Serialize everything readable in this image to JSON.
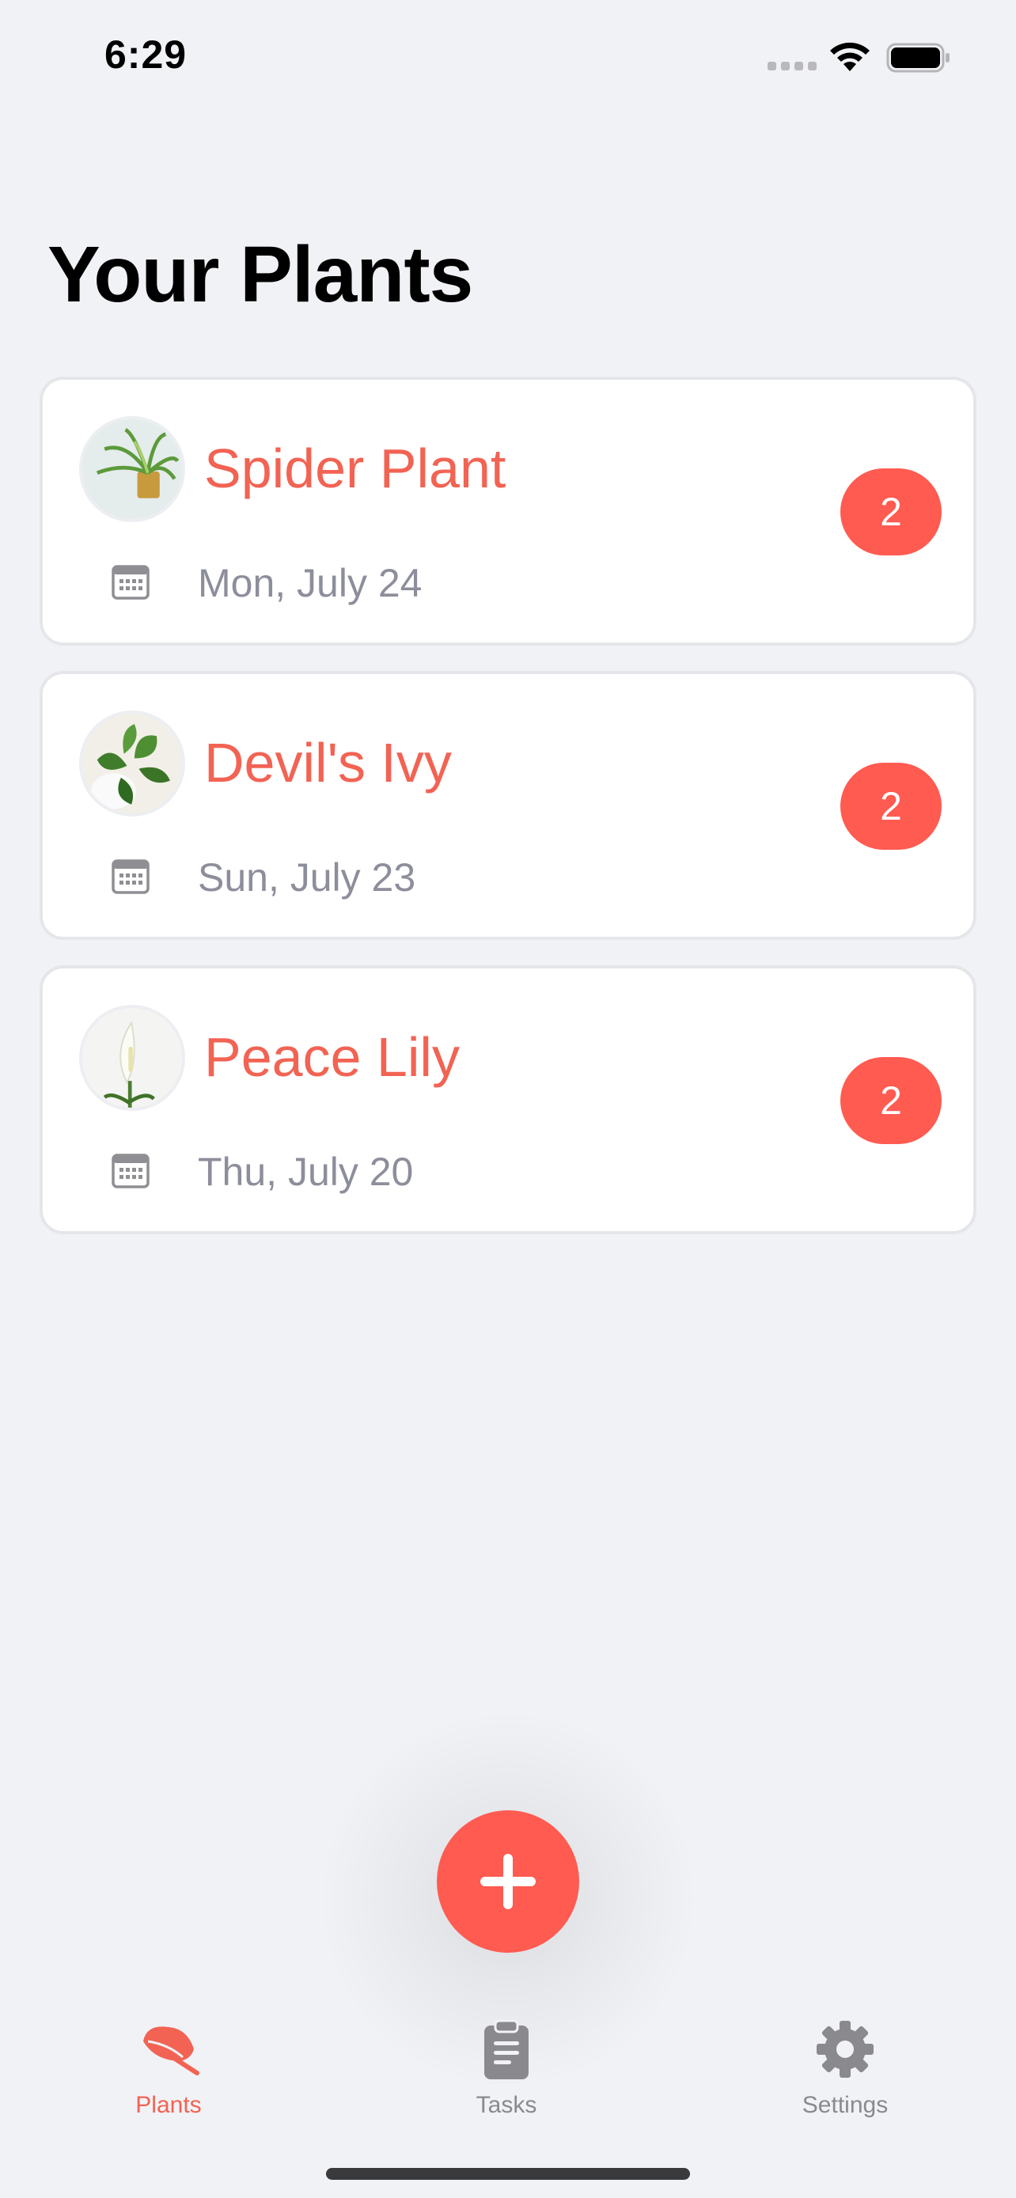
{
  "status_bar": {
    "time": "6:29"
  },
  "header": {
    "title": "Your Plants"
  },
  "plants": [
    {
      "name": "Spider Plant",
      "date": "Mon, July 24",
      "badge": "2"
    },
    {
      "name": "Devil's Ivy",
      "date": "Sun, July 23",
      "badge": "2"
    },
    {
      "name": "Peace Lily",
      "date": "Thu, July 20",
      "badge": "2"
    }
  ],
  "fab": {
    "icon": "plus-icon"
  },
  "tab_bar": {
    "tabs": [
      {
        "label": "Plants",
        "icon": "leaf-icon",
        "active": true
      },
      {
        "label": "Tasks",
        "icon": "clipboard-icon",
        "active": false
      },
      {
        "label": "Settings",
        "icon": "gear-icon",
        "active": false
      }
    ]
  },
  "colors": {
    "accent": "#ff5b51",
    "plant_name": "#f26353",
    "date_text": "#8d8e9b",
    "background": "#f1f2f6"
  }
}
